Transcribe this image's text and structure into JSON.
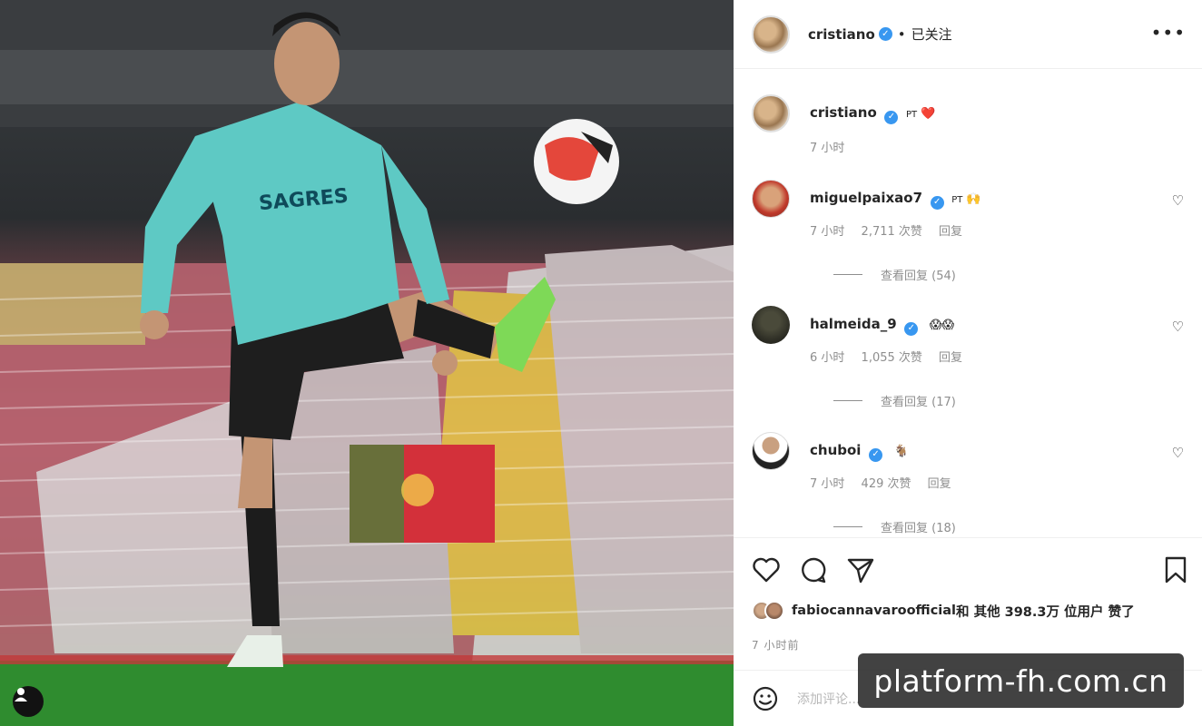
{
  "post": {
    "author": "cristiano",
    "follow_status": "已关注",
    "more": "•••",
    "separator": "•"
  },
  "caption": {
    "username": "cristiano",
    "text": "PT",
    "emoji": "❤️",
    "time": "7 小时"
  },
  "comments": [
    {
      "username": "miguelpaixao7",
      "text": "PT",
      "emoji": "🙌",
      "time": "7 小时",
      "likes": "2,711 次赞",
      "reply": "回复",
      "view_replies": "查看回复 (54)"
    },
    {
      "username": "halmeida_9",
      "text": "",
      "emoji": "😱😱",
      "time": "6 小时",
      "likes": "1,055 次赞",
      "reply": "回复",
      "view_replies": "查看回复 (17)"
    },
    {
      "username": "chuboi",
      "text": "",
      "emoji": "🐐",
      "time": "7 小时",
      "likes": "429 次赞",
      "reply": "回复",
      "view_replies": "查看回复 (18)"
    }
  ],
  "likes_line": {
    "user": "fabiocannavaroofficial",
    "rest": " 和 其他 398.3万 位用户 赞了"
  },
  "posted_ago": "7 小时前",
  "add_comment_placeholder": "添加评论...",
  "watermark": "platform-fh.com.cn",
  "photo": {
    "shirt_text": "SAGRES"
  },
  "colors": {
    "verified": "#3897f0",
    "heart": "#ed4956",
    "shirt": "#5ec9c4",
    "pitch": "#2f8c2f"
  },
  "icons": {
    "like": "heart-icon",
    "comment": "comment-icon",
    "share": "paper-plane-icon",
    "save": "bookmark-icon",
    "emoji": "smiley-icon",
    "user_tag": "person-icon"
  }
}
